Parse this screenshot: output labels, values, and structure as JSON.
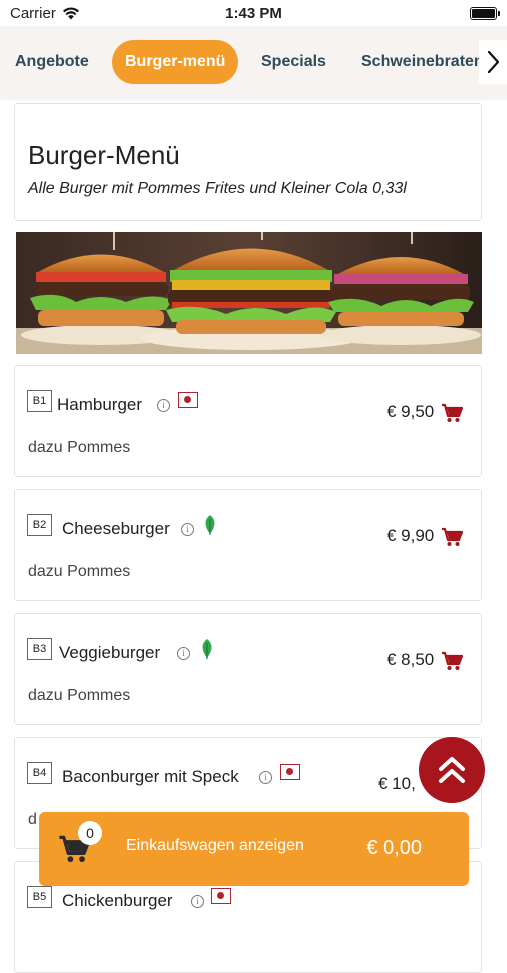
{
  "status_bar": {
    "carrier": "Carrier",
    "time": "1:43 PM"
  },
  "tabs": [
    {
      "label": "Angebote",
      "active": false
    },
    {
      "label": "Burger-menü",
      "active": true
    },
    {
      "label": "Specials",
      "active": false
    },
    {
      "label": "Schweinebraten",
      "active": false
    }
  ],
  "section": {
    "title": "Burger-Menü",
    "subtitle": "Alle Burger mit Pommes Frites und Kleiner Cola 0,33l"
  },
  "items": [
    {
      "code": "B1",
      "name": "Hamburger",
      "price": "€ 9,50",
      "description": "dazu Pommes",
      "diet_icon": "halal-flag-icon"
    },
    {
      "code": "B2",
      "name": "Cheeseburger",
      "price": "€ 9,90",
      "description": "dazu Pommes",
      "diet_icon": "vegetarian-leaf-icon"
    },
    {
      "code": "B3",
      "name": "Veggieburger",
      "price": "€ 8,50",
      "description": "dazu Pommes",
      "diet_icon": "vegetarian-leaf-icon"
    },
    {
      "code": "B4",
      "name": "Baconburger mit Speck",
      "price": "€ 10,",
      "description": "d",
      "diet_icon": "halal-flag-icon"
    },
    {
      "code": "B5",
      "name": "Chickenburger",
      "price": "",
      "description": "",
      "diet_icon": "halal-flag-icon"
    }
  ],
  "cart": {
    "count": "0",
    "label": "Einkaufswagen anzeigen",
    "total": "€ 0,00"
  },
  "colors": {
    "accent": "#f39c2a",
    "brand_red": "#a9151c",
    "tab_text": "#2f4a5a"
  },
  "icons": {
    "chevron": "chevron-right-icon",
    "scroll_top": "double-chevron-up-icon",
    "cart": "cart-icon",
    "info": "info-icon"
  }
}
